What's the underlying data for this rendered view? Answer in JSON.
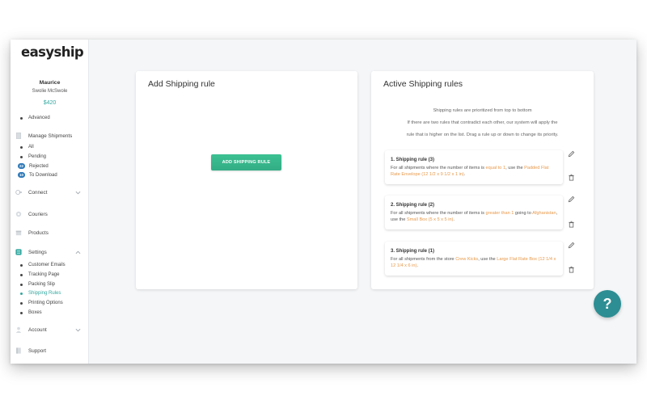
{
  "app": {
    "logo_text": "easyship"
  },
  "user": {
    "name": "Maurice",
    "company": "Swolie McSwole",
    "balance": "$420"
  },
  "sidebar": {
    "advanced": "Advanced",
    "manage_shipments": "Manage Shipments",
    "shipments": [
      {
        "label": "All"
      },
      {
        "label": "Pending"
      },
      {
        "label": "Rejected",
        "badge": "22"
      },
      {
        "label": "To Download",
        "badge": "10"
      }
    ],
    "connect": "Connect",
    "couriers": "Couriers",
    "products": "Products",
    "settings": "Settings",
    "settings_items": [
      {
        "label": "Customer Emails"
      },
      {
        "label": "Tracking Page"
      },
      {
        "label": "Packing Slip"
      },
      {
        "label": "Shipping Rules",
        "active": true
      },
      {
        "label": "Printing Options"
      },
      {
        "label": "Boxes"
      }
    ],
    "account": "Account",
    "support": "Support"
  },
  "add_card": {
    "title": "Add Shipping rule",
    "button_label": "ADD SHIPPING RULE"
  },
  "active_card": {
    "title": "Active Shipping rules",
    "info": [
      "Shipping rules are prioritized from top to bottom",
      "If there are two rules that contradict each other, our system will apply the",
      "rule that is higher on the list. Drag a rule up or down to change its priority."
    ],
    "rules": [
      {
        "title": "1. Shipping rule (3)",
        "desc": [
          {
            "t": "For all shipments where the number of items is "
          },
          {
            "t": "equal to 1",
            "hl": true
          },
          {
            "t": ", use the "
          },
          {
            "t": "Padded Flat Rate Envelope (12 1/2 x 9 1/2 x 1 in)",
            "hl": true
          },
          {
            "t": "."
          }
        ]
      },
      {
        "title": "2. Shipping rule (2)",
        "desc": [
          {
            "t": "For all shipments where the number of items is "
          },
          {
            "t": "greater than 1",
            "hl": true
          },
          {
            "t": " going to "
          },
          {
            "t": "Afghanistan",
            "hl": true
          },
          {
            "t": ", use the "
          },
          {
            "t": "Small Box (5 x 5 x 5 in)",
            "hl": true
          },
          {
            "t": "."
          }
        ]
      },
      {
        "title": "3. Shipping rule (1)",
        "desc": [
          {
            "t": "For all shipments from the store "
          },
          {
            "t": "Crew Kicks",
            "hl": true
          },
          {
            "t": ", use the "
          },
          {
            "t": "Large Flat Rate Box (12 1/4 x 12 1/4 x 6 in)",
            "hl": true
          },
          {
            "t": "."
          }
        ]
      }
    ]
  },
  "help": {
    "label": "?"
  },
  "colors": {
    "accent": "#34a8a0",
    "button": "#36b489",
    "highlight": "#e8994a",
    "help": "#2d8e93",
    "badge": "#2c78b8"
  },
  "icons": [
    "edit-icon",
    "trash-icon",
    "chevron-down-icon",
    "chevron-up-icon"
  ]
}
